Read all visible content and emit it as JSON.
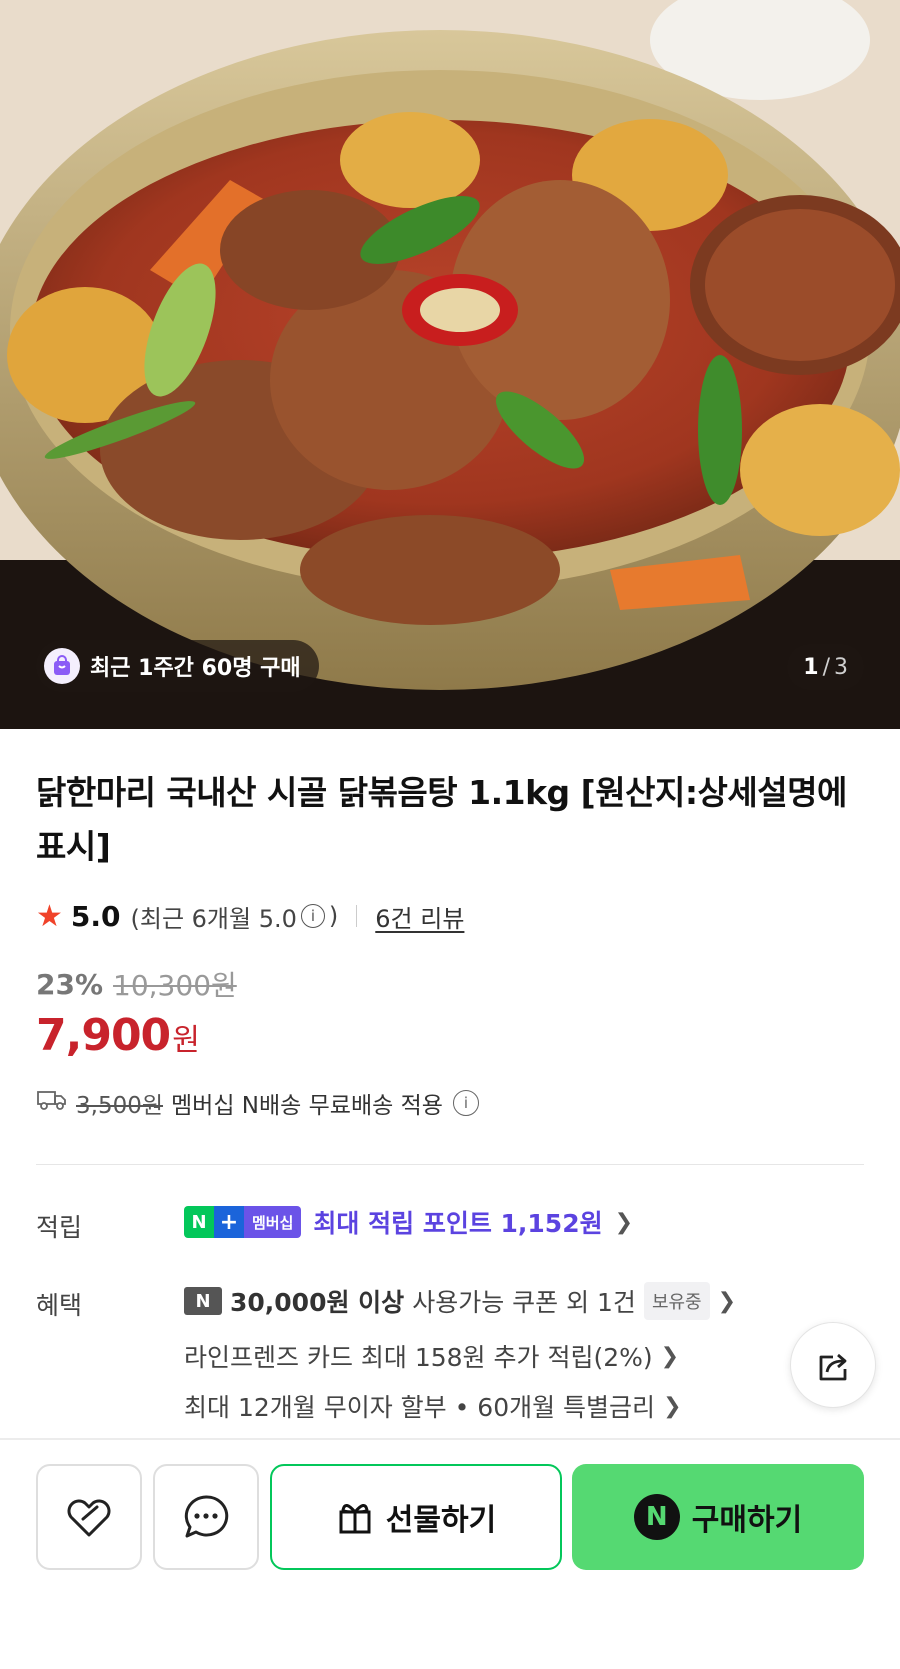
{
  "hero": {
    "recent_purchase_badge": "최근 1주간 60명 구매",
    "counter": {
      "current": "1",
      "separator": "/",
      "total": "3"
    }
  },
  "product": {
    "title": "닭한마리 국내산 시골 닭볶음탕 1.1kg [원산지:상세설명에 표시]"
  },
  "rating": {
    "score": "5.0",
    "recent_text": "(최근 6개월 5.0",
    "recent_close": ")",
    "review_link": "6건 리뷰"
  },
  "price": {
    "discount_pct": "23%",
    "original": "10,300원",
    "sale": "7,900",
    "sale_unit": "원"
  },
  "shipping": {
    "original_fee": "3,500원",
    "text": "멤버십 N배송 무료배송 적용"
  },
  "points": {
    "label": "적립",
    "badge_n": "N",
    "badge_plus": "+",
    "badge_membership": "멤버십",
    "text": "최대 적립 포인트 1,152원"
  },
  "benefits": {
    "label": "혜택",
    "coupon_icon": "N",
    "coupon_amount": "30,000원 이상",
    "coupon_text": "사용가능 쿠폰 외 1건",
    "coupon_held": "보유중",
    "card_text": "라인프렌즈 카드 최대 158원 추가 적립(2%)",
    "installment_text": "최대 12개월 무이자 할부 • 60개월 특별금리"
  },
  "bottom_bar": {
    "gift_label": "선물하기",
    "buy_logo": "N",
    "buy_label": "구매하기"
  },
  "icons": [
    "shopping-bag-icon",
    "star-icon",
    "info-icon",
    "truck-icon",
    "chevron-right-icon",
    "share-icon",
    "heart-icon",
    "chat-bubble-icon",
    "gift-icon"
  ],
  "colors": {
    "sale_price": "#c8232c",
    "points_purple": "#5b43e0",
    "naver_green": "#03c75a",
    "buy_button": "#55d972",
    "star": "#f0432a"
  }
}
